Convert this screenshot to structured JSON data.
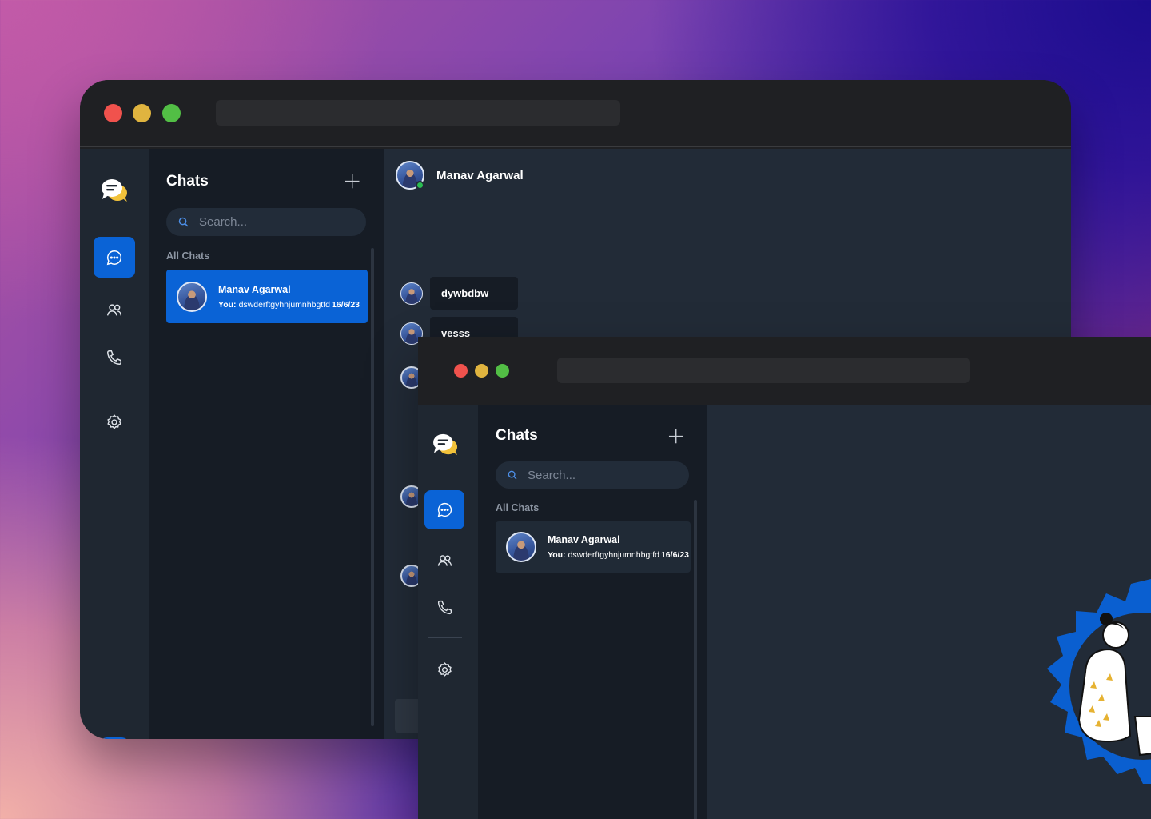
{
  "back_window": {
    "app": {
      "rail": {
        "logo_icon": "chat-bubbles-logo-icon",
        "items": [
          {
            "icon": "message-icon",
            "active": true
          },
          {
            "icon": "users-icon",
            "active": false
          },
          {
            "icon": "phone-icon",
            "active": false
          },
          {
            "icon": "settings-icon",
            "active": false
          }
        ],
        "dark_mode_toggle": true
      },
      "panel": {
        "title": "Chats",
        "search_placeholder": "Search...",
        "section_label": "All Chats",
        "chats": [
          {
            "name": "Manav Agarwal",
            "you_label": "You:",
            "preview": "dswderftgyhnjumnhbgtfd",
            "time": "16/6/23",
            "active": true
          }
        ]
      },
      "conversation": {
        "contact_name": "Manav Agarwal",
        "online": true,
        "messages": [
          {
            "text": "dywbdbw"
          },
          {
            "text": "vesss"
          }
        ]
      }
    }
  },
  "front_window": {
    "app": {
      "panel": {
        "title": "Chats",
        "search_placeholder": "Search...",
        "section_label": "All Chats",
        "chats": [
          {
            "name": "Manav Agarwal",
            "you_label": "You:",
            "preview": "dswderftgyhnjumnhbgtfd",
            "time": "16/6/23",
            "active": false
          }
        ]
      }
    }
  },
  "colors": {
    "accent": "#0a63d6",
    "online": "#2bbd52",
    "window_chrome": "#1f2023",
    "traffic_red": "#f0524d",
    "traffic_yellow": "#e0b43f",
    "traffic_green": "#52be45"
  }
}
